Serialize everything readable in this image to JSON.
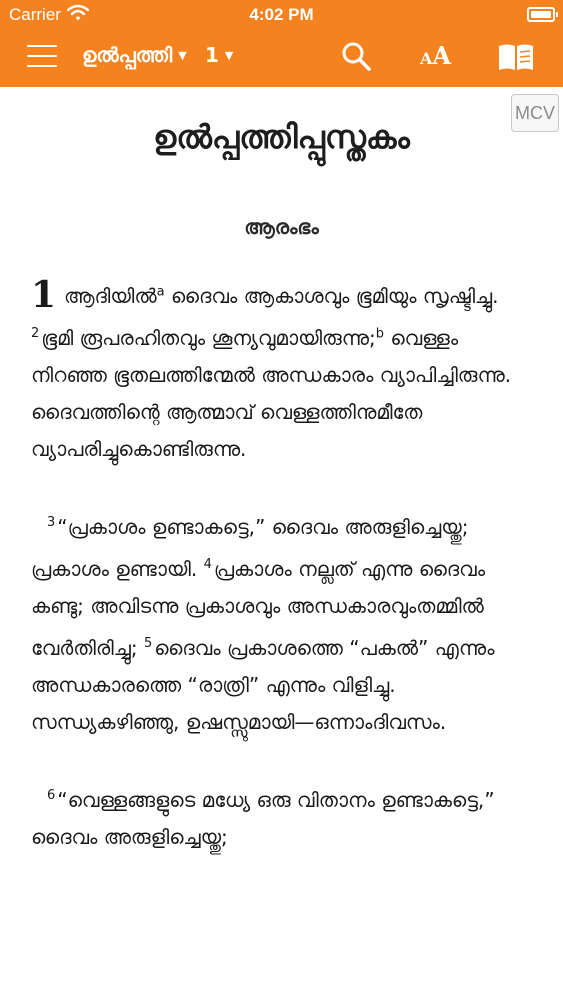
{
  "status_bar": {
    "carrier": "Carrier",
    "time": "4:02 PM"
  },
  "toolbar": {
    "book": "ഉൽപ്പത്തി",
    "chapter": "1",
    "icons": [
      "hamburger-menu-icon",
      "search-icon",
      "font-size-icon",
      "book-reader-icon"
    ],
    "font_icon_text": {
      "small": "A",
      "big": "A"
    }
  },
  "version_badge": "MCV",
  "colors": {
    "accent": "#f4831f",
    "text": "#1a1a1a",
    "badge_text": "#8b8b8b"
  },
  "book_title": "ഉൽപ്പത്തിപ്പുസ്തകം",
  "section_heading": "ആരംഭം",
  "chapter_number": "1",
  "verses": {
    "v1": "ആദിയിൽ",
    "fn_a": "a",
    "v1_rest": " ദൈവം ആകാശവും ഭൂമിയും സൃഷ്ടിച്ചു. ",
    "v2_num": "2",
    "v2": "ഭൂമി രൂപരഹിതവും ശൂന്യവുമായിരുന്നു;",
    "fn_b": "b",
    "v2_rest": " വെള്ളം നിറഞ്ഞ ഭൂതലത്തിന്മേൽ അന്ധകാരം വ്യാപിച്ചിരുന്നു. ദൈവത്തിന്റെ ആത്മാവ് വെള്ളത്തിനുമീതേ വ്യാപരിച്ചുകൊണ്ടിരുന്നു.",
    "v3_num": "3",
    "v3": "“പ്രകാശം ഉണ്ടാകട്ടെ,” ദൈവം അരുളിച്ചെയ്തു; പ്രകാശം ഉണ്ടായി. ",
    "v4_num": "4",
    "v4": "പ്രകാശം നല്ലത് എന്നു ദൈവം കണ്ടു; അവിടന്നു പ്രകാശവും അന്ധകാരവുംതമ്മിൽ വേർതിരിച്ചു; ",
    "v5_num": "5",
    "v5": "ദൈവം പ്രകാശത്തെ “പകൽ” എന്നും അന്ധകാരത്തെ “രാത്രി” എന്നും വിളിച്ചു. സന്ധ്യകഴിഞ്ഞു, ഉഷസ്സുമായി—ഒന്നാംദിവസം.",
    "v6_num": "6",
    "v6": "“വെള്ളങ്ങളുടെ മധ്യേ ഒരു വിതാനം ഉണ്ടാകട്ടെ,” ദൈവം അരുളിച്ചെയ്തു;"
  }
}
